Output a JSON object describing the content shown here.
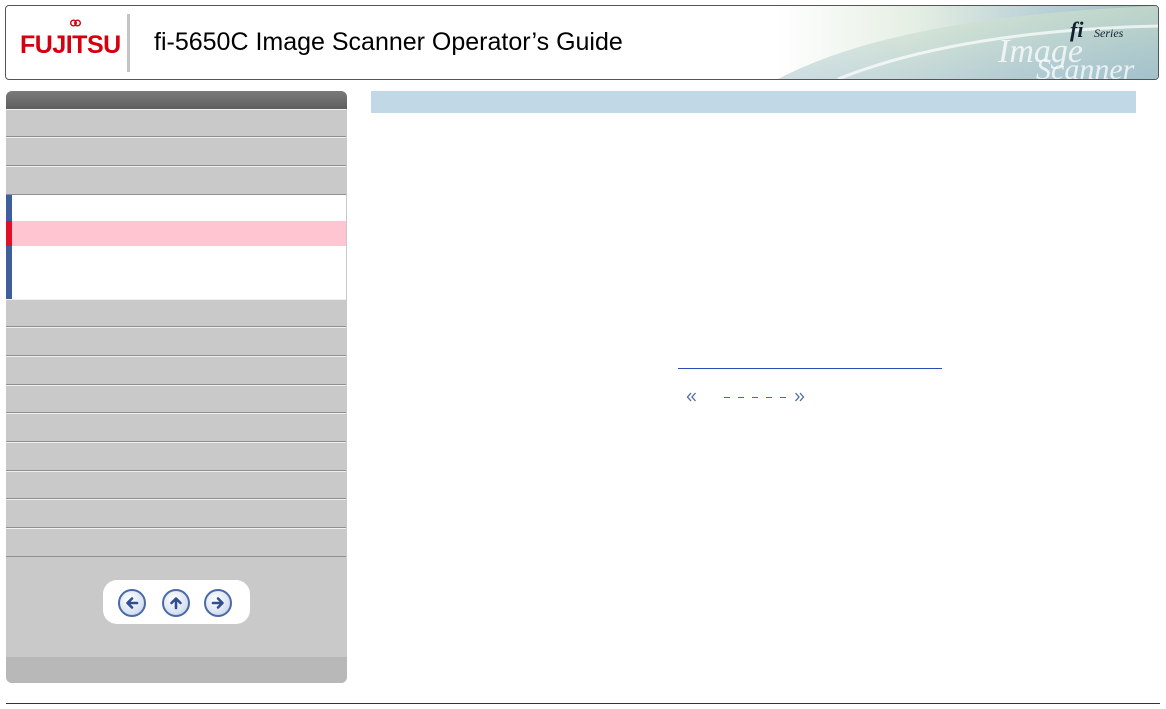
{
  "header": {
    "brand": "FUJITSU",
    "title": "fi-5650C Image Scanner Operator’s Guide",
    "badge_fi": "fi",
    "badge_series": "Series"
  },
  "sidebar": {
    "items_top": [
      "",
      "",
      ""
    ],
    "expanded_children": [
      "",
      "",
      ""
    ],
    "items_bottom": [
      "",
      "",
      "",
      "",
      "",
      "",
      "",
      "",
      ""
    ],
    "nav": {
      "back": "back",
      "up": "up",
      "forward": "forward"
    }
  },
  "main": {
    "heading": "",
    "link_text": "",
    "pager": {
      "prev_symbol": "«",
      "next_symbol": "»"
    }
  },
  "colors": {
    "brand_red": "#d4000f",
    "current_item_bg": "#ffc6d2",
    "current_marker": "#e0102a",
    "section_accent": "#3e5f9c",
    "heading_bar": "#c1d8e6",
    "link": "#2b4ab3"
  },
  "icons": [
    "back-arrow-icon",
    "up-arrow-icon",
    "forward-arrow-icon",
    "double-chevron-left-icon",
    "double-chevron-right-icon"
  ]
}
